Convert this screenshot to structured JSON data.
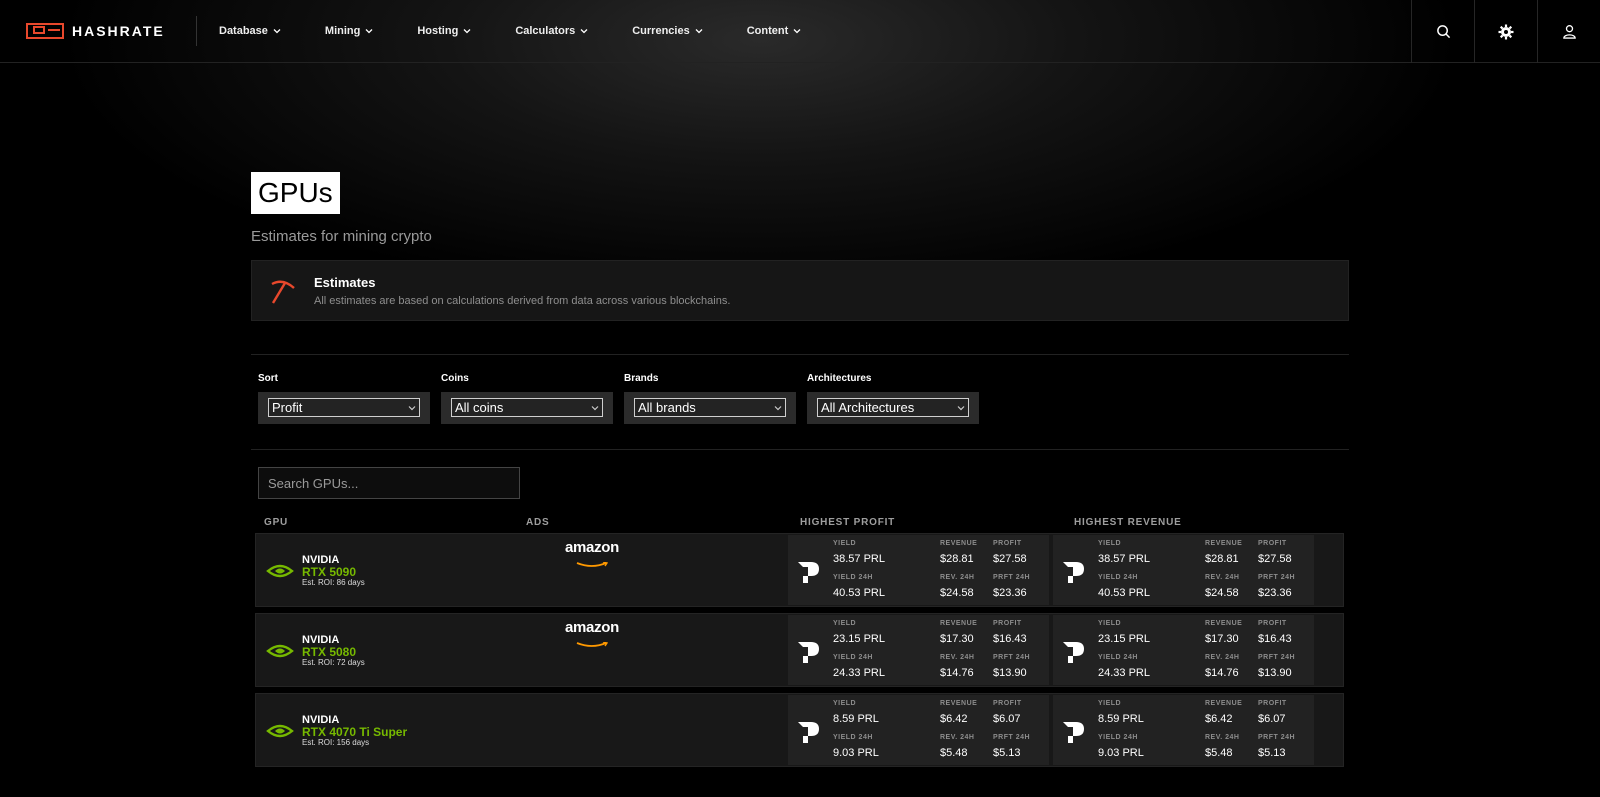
{
  "brand": {
    "logo_text": "HASHRATE",
    "accent": "#e8482c"
  },
  "nav": [
    {
      "label": "Database"
    },
    {
      "label": "Mining"
    },
    {
      "label": "Hosting"
    },
    {
      "label": "Calculators"
    },
    {
      "label": "Currencies"
    },
    {
      "label": "Content"
    }
  ],
  "header_icons": [
    "search-icon",
    "gear-icon",
    "user-icon"
  ],
  "page": {
    "title": "GPUs",
    "subtitle": "Estimates for mining crypto"
  },
  "notice": {
    "title": "Estimates",
    "text": "All estimates are based on calculations derived from data across various blockchains."
  },
  "filters": [
    {
      "label": "Sort",
      "value": "Profit"
    },
    {
      "label": "Coins",
      "value": "All coins"
    },
    {
      "label": "Brands",
      "value": "All brands"
    },
    {
      "label": "Architectures",
      "value": "All Architectures"
    }
  ],
  "search": {
    "placeholder": "Search GPUs..."
  },
  "columns": {
    "gpu": "GPU",
    "ads": "ADS",
    "highest_profit": "HIGHEST PROFIT",
    "highest_revenue": "HIGHEST REVENUE"
  },
  "labels": {
    "yield": "YIELD",
    "revenue": "REVENUE",
    "profit": "PROFIT",
    "yield_24h": "YIELD 24H",
    "rev_24h": "REV. 24H",
    "prft_24h": "PRFT 24H"
  },
  "ad_text": "amazon",
  "gpus": [
    {
      "brand": "NVIDIA",
      "model": "RTX 5090",
      "roi": "Est. ROI: 86 days",
      "ad": true,
      "profit_card": {
        "yield": "38.57 PRL",
        "revenue": "$28.81",
        "profit": "$27.58",
        "yield_24h": "40.53 PRL",
        "rev_24h": "$24.58",
        "prft_24h": "$23.36"
      },
      "revenue_card": {
        "yield": "38.57 PRL",
        "revenue": "$28.81",
        "profit": "$27.58",
        "yield_24h": "40.53 PRL",
        "rev_24h": "$24.58",
        "prft_24h": "$23.36"
      }
    },
    {
      "brand": "NVIDIA",
      "model": "RTX 5080",
      "roi": "Est. ROI: 72 days",
      "ad": true,
      "profit_card": {
        "yield": "23.15 PRL",
        "revenue": "$17.30",
        "profit": "$16.43",
        "yield_24h": "24.33 PRL",
        "rev_24h": "$14.76",
        "prft_24h": "$13.90"
      },
      "revenue_card": {
        "yield": "23.15 PRL",
        "revenue": "$17.30",
        "profit": "$16.43",
        "yield_24h": "24.33 PRL",
        "rev_24h": "$14.76",
        "prft_24h": "$13.90"
      }
    },
    {
      "brand": "NVIDIA",
      "model": "RTX 4070 Ti Super",
      "roi": "Est. ROI: 156 days",
      "ad": false,
      "profit_card": {
        "yield": "8.59 PRL",
        "revenue": "$6.42",
        "profit": "$6.07",
        "yield_24h": "9.03 PRL",
        "rev_24h": "$5.48",
        "prft_24h": "$5.13"
      },
      "revenue_card": {
        "yield": "8.59 PRL",
        "revenue": "$6.42",
        "profit": "$6.07",
        "yield_24h": "9.03 PRL",
        "rev_24h": "$5.48",
        "prft_24h": "$5.13"
      }
    }
  ]
}
